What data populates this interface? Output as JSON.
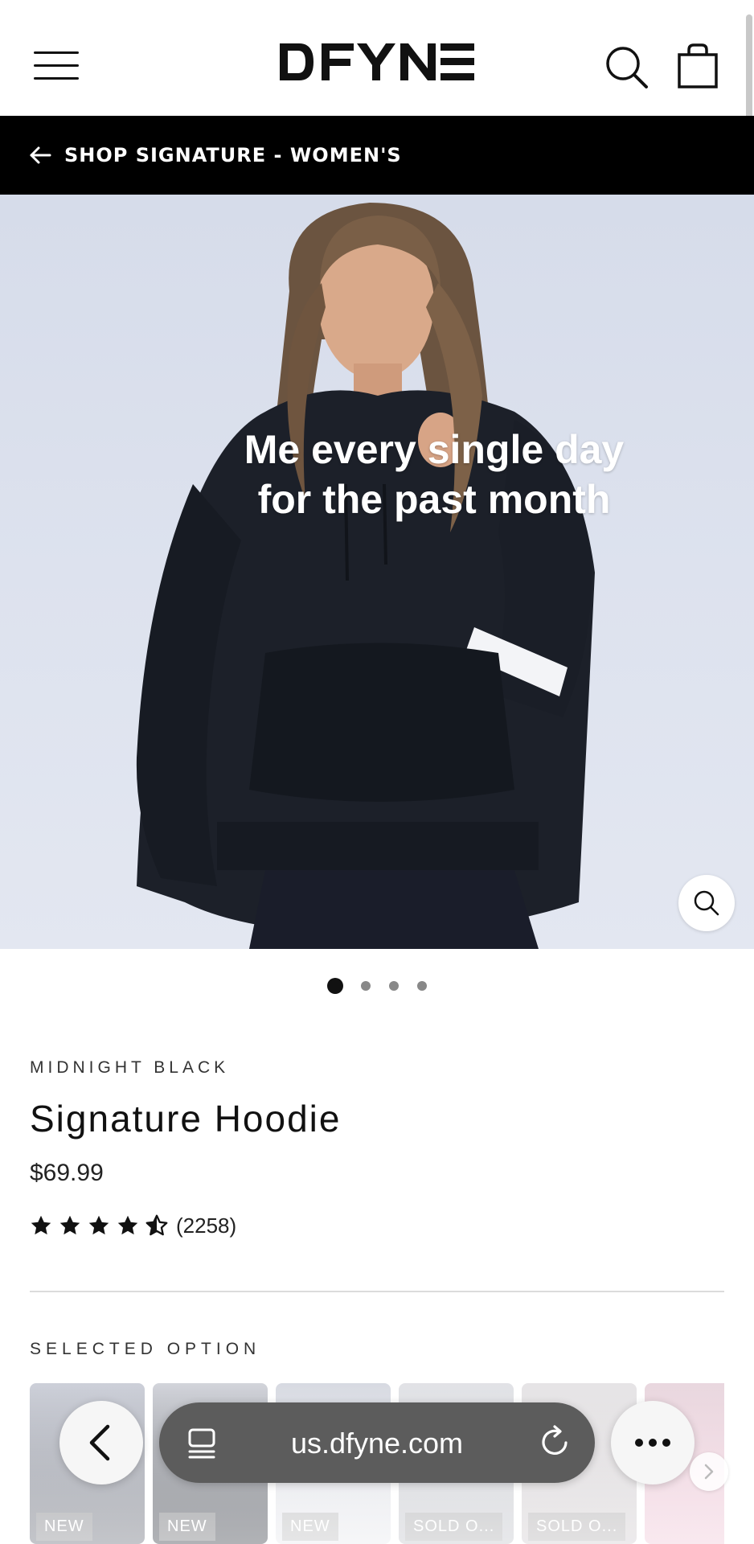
{
  "header": {
    "logo_text": "DFYNE",
    "icons": [
      "menu-icon",
      "search-icon",
      "cart-icon"
    ]
  },
  "banner": {
    "label": "SHOP SIGNATURE - WOMEN'S"
  },
  "hero": {
    "caption_line1": "Me every single day",
    "caption_line2": "for the past month",
    "slide_count": 4,
    "active_slide": 1
  },
  "product": {
    "color_name": "MIDNIGHT BLACK",
    "title": "Signature Hoodie",
    "price": "$69.99",
    "rating": 4.5,
    "review_count": "(2258)"
  },
  "options": {
    "section_label": "SELECTED OPTION",
    "thumbnails": [
      {
        "badge": "NEW"
      },
      {
        "badge": "NEW"
      },
      {
        "badge": "NEW"
      },
      {
        "badge": "SOLD O..."
      },
      {
        "badge": "SOLD O..."
      },
      {
        "badge": ""
      }
    ]
  },
  "browser": {
    "url": "us.dfyne.com"
  },
  "colors": {
    "banner_bg": "#000000",
    "url_pill": "#5c5c5c"
  }
}
